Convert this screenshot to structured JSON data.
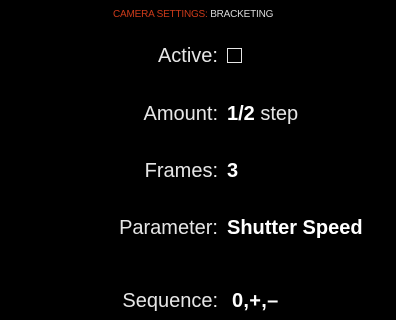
{
  "header": {
    "path": "CAMERA SETTINGS:",
    "current": "BRACKETING"
  },
  "settings": {
    "active": {
      "label": "Active:",
      "checked": false
    },
    "amount": {
      "label": "Amount:",
      "value": "1/2",
      "unit": "step"
    },
    "frames": {
      "label": "Frames:",
      "value": "3"
    },
    "parameter": {
      "label": "Parameter:",
      "value": "Shutter Speed"
    },
    "sequence": {
      "label": "Sequence:",
      "value": "0,+,–"
    }
  },
  "colors": {
    "background": "#000000",
    "header_path": "#cc3a1a",
    "text": "#e6e6e6",
    "value": "#ffffff"
  }
}
